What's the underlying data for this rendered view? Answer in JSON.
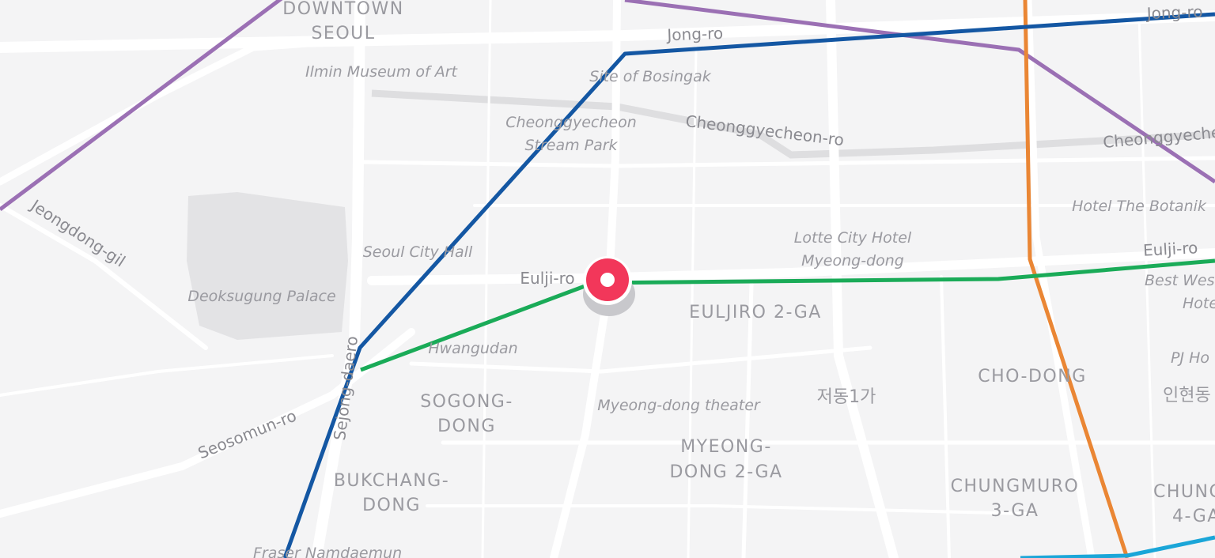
{
  "map": {
    "district_labels": [
      "DOWNTOWN",
      "SEOUL",
      "EULJIRO 2-GA",
      "CHO-DONG",
      "SOGONG-",
      "DONG",
      "MYEONG-",
      "DONG 2-GA",
      "BUKCHANG-",
      "DONG",
      "CHUNGMURO",
      "3-GA",
      "CHUNGM",
      "4-GA"
    ],
    "poi_labels": [
      "Ilmin Museum of Art",
      "Site of Bosingak",
      "Cheonggyecheon",
      "Stream Park",
      "Seoul City Hall",
      "Deoksugung Palace",
      "Hwangudan",
      "Myeong-dong theater",
      "Lotte City Hotel",
      "Myeong-dong",
      "Hotel The Botanik",
      "Best Wes",
      "Hote",
      "PJ Ho",
      "Fraser Namdaemun"
    ],
    "road_labels": [
      "Jong-ro",
      "Jong-ro",
      "Cheonggyecheon-ro",
      "Cheonggyecheon",
      "Jeongdong-gil",
      "Eulji-ro",
      "Eulji-ro",
      "Sejong-daero",
      "Seosomun-ro"
    ],
    "korean_labels": [
      "저동1가",
      "인현동"
    ],
    "line_colors": {
      "purple": "#9b70b4",
      "blue": "#1457a3",
      "green": "#1aab58",
      "orange": "#ea8634",
      "cyan": "#1ba6d8"
    },
    "marker": {
      "icon": "location-pin-icon",
      "color": "#f2375a"
    }
  }
}
